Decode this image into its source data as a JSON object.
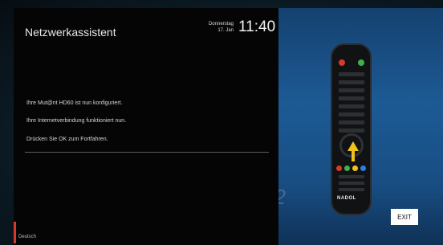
{
  "header": {
    "title": "Netzwerkassistent",
    "date_day": "Donnerstag",
    "date_date": "17. Jan",
    "time": "11:40"
  },
  "messages": [
    "Ihre Mut@nt HD60 ist nun konfiguriert.",
    "Ihre Internetverbindung funktioniert nun.",
    "Drücken Sie OK zum Fortfahren."
  ],
  "footer": {
    "language": "Deutsch"
  },
  "buttons": {
    "exit": "EXIT"
  },
  "remote": {
    "brand": "NADOL"
  },
  "background": {
    "ghost_text": "6.2"
  },
  "colors": {
    "accent_red": "#d63a2a",
    "arrow_yellow": "#f1c21b",
    "panel": "#050506"
  }
}
